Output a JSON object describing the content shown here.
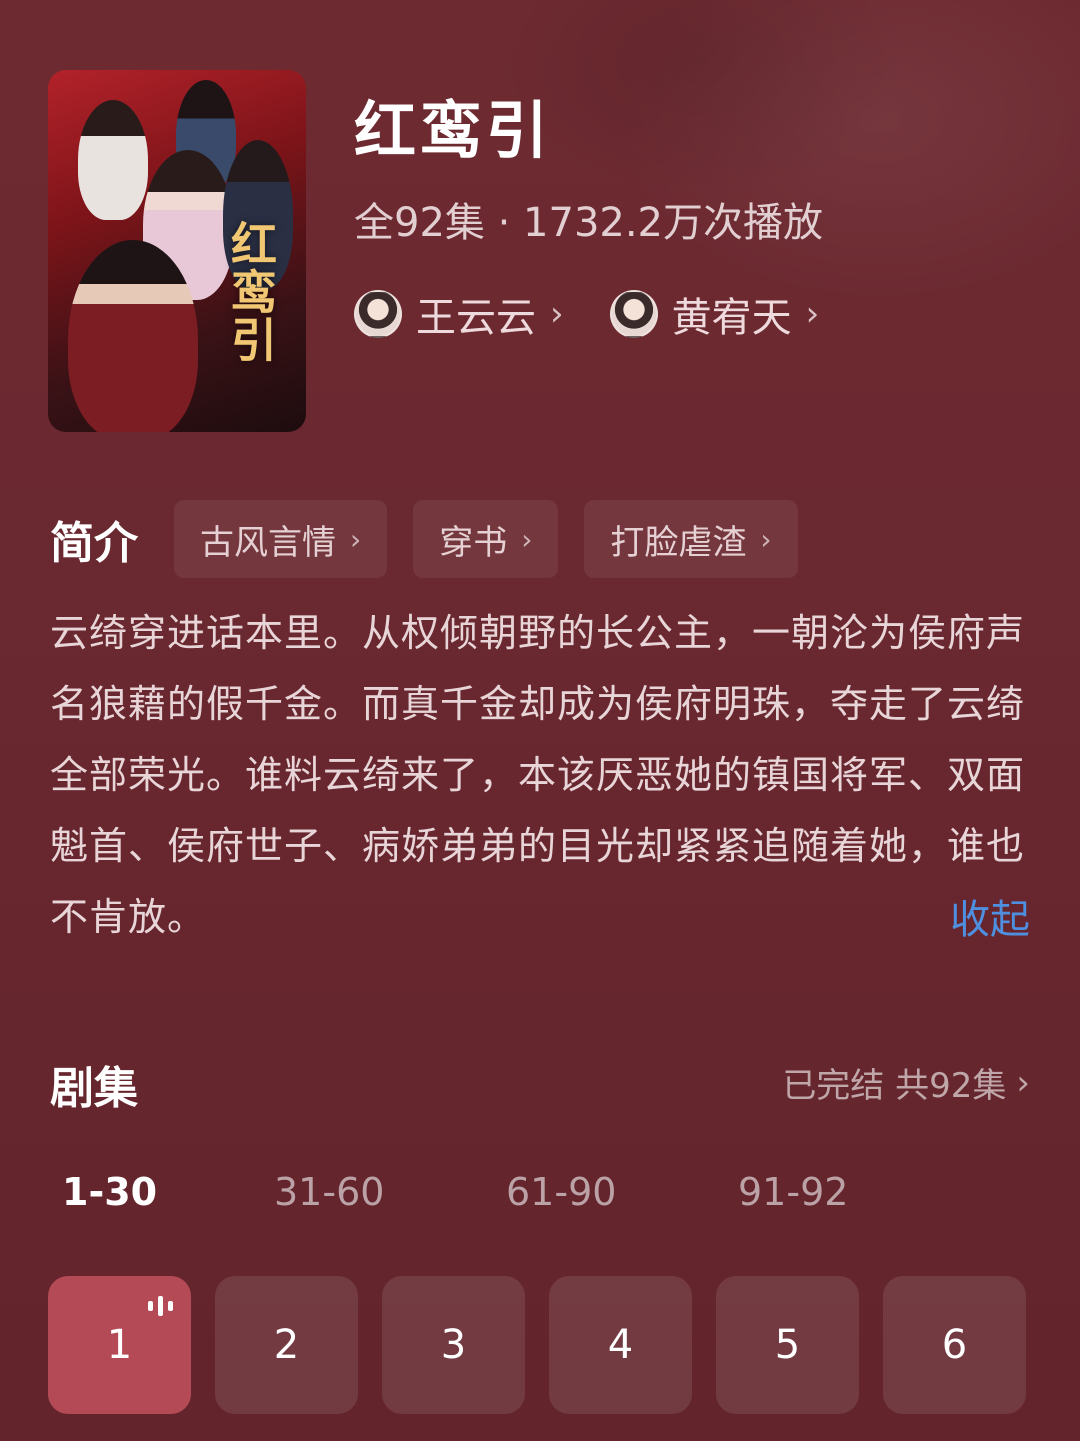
{
  "drama": {
    "title": "红鸾引",
    "poster_title": "红鸾引",
    "meta": "全92集 · 1732.2万次播放",
    "actors": [
      {
        "name": "王云云"
      },
      {
        "name": "黄宥天"
      }
    ]
  },
  "intro": {
    "label": "简介",
    "tags": [
      {
        "label": "古风言情"
      },
      {
        "label": "穿书"
      },
      {
        "label": "打脸虐渣"
      }
    ],
    "description": "云绮穿进话本里。从权倾朝野的长公主，一朝沦为侯府声名狼藉的假千金。而真千金却成为侯府明珠，夺走了云绮全部荣光。谁料云绮来了，本该厌恶她的镇国将军、双面魁首、侯府世子、病娇弟弟的目光却紧紧追随着她，谁也不肯放。",
    "collapse_label": "收起"
  },
  "episodes": {
    "label": "剧集",
    "status": "已完结 共92集",
    "ranges": [
      "1-30",
      "31-60",
      "61-90",
      "91-92"
    ],
    "active_range": "1-30",
    "items": [
      "1",
      "2",
      "3",
      "4",
      "5",
      "6"
    ],
    "playing": "1"
  },
  "icons": {
    "chevron": "chevron-right-icon",
    "playing": "audio-bars-icon"
  },
  "colors": {
    "background": "#6a2830",
    "accent_link": "#4f8fe0",
    "active_episode": "#b44a55"
  }
}
